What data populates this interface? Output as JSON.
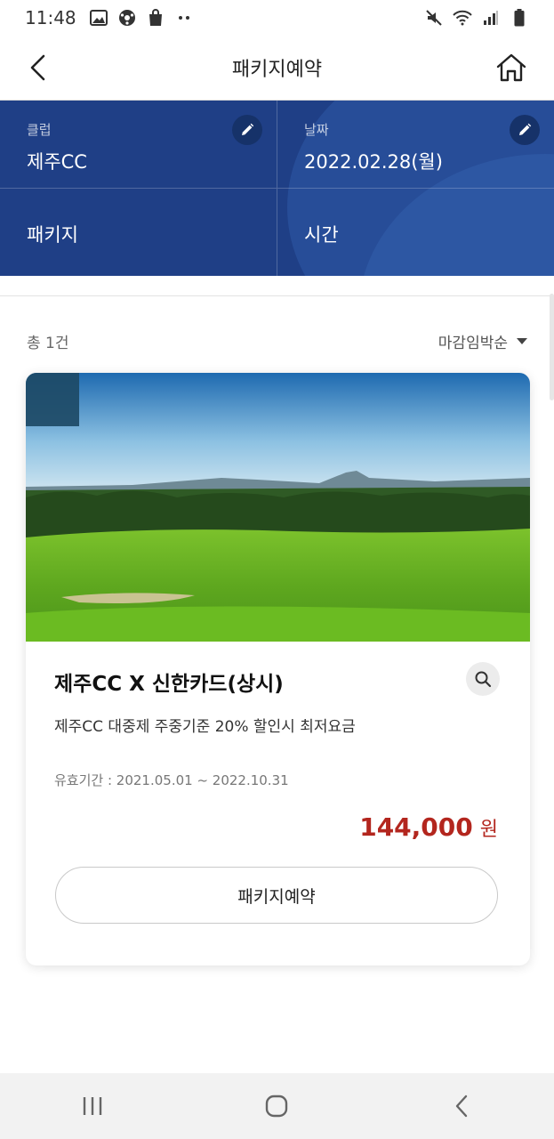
{
  "status_bar": {
    "time": "11:48",
    "left_icons": [
      "gallery-icon",
      "soccer-ball-icon",
      "shopping-bag-icon",
      "more-dots-icon"
    ],
    "right_icons": [
      "mute-icon",
      "wifi-icon",
      "signal-icon",
      "battery-icon"
    ]
  },
  "header": {
    "title": "패키지예약",
    "back_icon": "chevron-left-icon",
    "home_icon": "home-icon"
  },
  "filters": {
    "club": {
      "label": "클럽",
      "value": "제주CC"
    },
    "date": {
      "label": "날짜",
      "value": "2022.02.28(월)"
    },
    "package": {
      "label": "패키지"
    },
    "time": {
      "label": "시간"
    },
    "edit_icon": "pencil-icon",
    "panel_color": "#1f3f86"
  },
  "list": {
    "count_text": "총 1건",
    "sort_label": "마감임박순"
  },
  "package_card": {
    "title": "제주CC X 신한카드(상시)",
    "description": "제주CC 대중제 주중기준 20% 할인시 최저요금",
    "period": "유효기간 : 2021.05.01 ~ 2022.10.31",
    "price": "144,000",
    "price_unit": "원",
    "price_color": "#b3261e",
    "reserve_label": "패키지예약",
    "detail_icon": "search-icon",
    "image_alt": "golf-course-photo"
  },
  "nav_bar": {
    "icons": [
      "recent-apps-icon",
      "home-button-icon",
      "back-icon"
    ]
  }
}
